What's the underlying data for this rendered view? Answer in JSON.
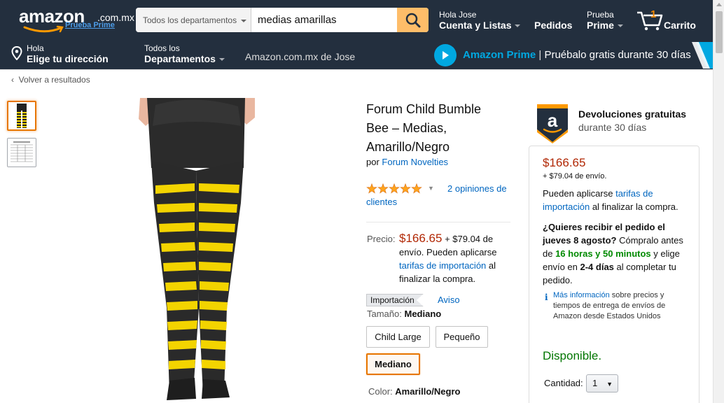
{
  "header": {
    "logo_text": "amazon",
    "logo_tld": ".com.mx",
    "logo_prime": "Prueba Prime",
    "search": {
      "department": "Todos los departamentos",
      "query": "medias amarillas"
    },
    "account": {
      "small": "Hola Jose",
      "big": "Cuenta y Listas"
    },
    "orders": {
      "big": "Pedidos"
    },
    "prime": {
      "small": "Prueba",
      "big": "Prime"
    },
    "cart": {
      "count": "1",
      "label": "Carrito"
    },
    "location": {
      "small": "Hola",
      "big": "Elige tu dirección"
    },
    "departments": {
      "small": "Todos los",
      "big": "Departamentos"
    },
    "personal_link": "Amazon.com.mx de Jose",
    "prime_banner": {
      "brand": "Amazon Prime",
      "sep": " | ",
      "text": "Pruébalo gratis durante 30 días"
    }
  },
  "breadcrumb": {
    "back": "Volver a resultados"
  },
  "product": {
    "title": "Forum Child Bumble Bee – Medias, Amarillo/Negro",
    "by_prefix": "por ",
    "brand": "Forum Novelties",
    "rating": 5,
    "reviews": "2 opiniones de clientes",
    "price_label": "Precio:",
    "price": "$166.65",
    "shipping_prefix": " + $79.04 de envío. Pueden aplicarse ",
    "import_fees_link": "tarifas de importación",
    "shipping_suffix": " al finalizar la compra.",
    "import_badge": "Importación",
    "aviso": "Aviso",
    "size_label": "Tamaño: ",
    "size_selected": "Mediano",
    "sizes": [
      "Child Large",
      "Pequeño",
      "Mediano"
    ],
    "color_label": "Color: ",
    "color_selected": "Amarillo/Negro"
  },
  "buybox": {
    "returns_title": "Devoluciones gratuitas",
    "returns_sub": "durante 30 días",
    "price": "$166.65",
    "shipping": "+ $79.04 de envío.",
    "tarifas_prefix": "Pueden aplicarse ",
    "tarifas_link": "tarifas de importación",
    "tarifas_suffix": " al finalizar la compra.",
    "delivery_q": "¿Quieres recibir el pedido el jueves 8 agosto?",
    "delivery_mid": " Cómpralo antes de ",
    "delivery_time": "16 horas y 50 minutos",
    "delivery_mid2": " y elige envío en ",
    "delivery_days": "2-4 días",
    "delivery_end": " al completar tu pedido.",
    "info_link": "Más información",
    "info_text": " sobre precios y tiempos de entrega de envíos de Amazon desde Estados Unidos",
    "availability": "Disponible.",
    "qty_label": "Cantidad:",
    "qty_value": "1"
  },
  "colors": {
    "nav": "#232f3e",
    "search_button": "#febd69",
    "price": "#b12704",
    "link": "#0066c0",
    "available": "#007600",
    "selected_border": "#e77600"
  }
}
